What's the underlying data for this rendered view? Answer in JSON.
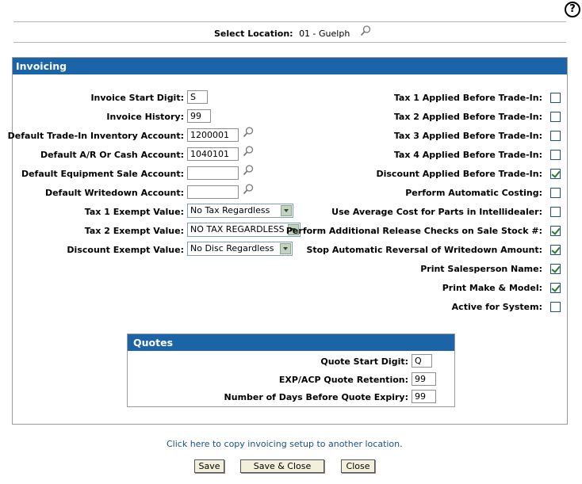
{
  "header": {
    "help_label": "?",
    "location_label": "Select Location:",
    "location_value": "01 - Guelph"
  },
  "invoicing": {
    "title": "Invoicing",
    "fields": {
      "invoice_start_digit": {
        "label": "Invoice Start Digit:",
        "value": "S"
      },
      "invoice_history": {
        "label": "Invoice History:",
        "value": "99"
      },
      "default_tradein_account": {
        "label": "Default Trade-In Inventory Account:",
        "value": "1200001"
      },
      "default_ar_cash_account": {
        "label": "Default A/R Or Cash Account:",
        "value": "1040101"
      },
      "default_equipment_sale_account": {
        "label": "Default Equipment Sale Account:",
        "value": ""
      },
      "default_writedown_account": {
        "label": "Default Writedown Account:",
        "value": ""
      },
      "tax1_exempt": {
        "label": "Tax 1 Exempt Value:",
        "value": "No Tax Regardless"
      },
      "tax2_exempt": {
        "label": "Tax 2 Exempt Value:",
        "value": "NO TAX REGARDLESS"
      },
      "discount_exempt": {
        "label": "Discount Exempt Value:",
        "value": "No Disc Regardless"
      }
    },
    "checks": [
      {
        "label": "Tax 1 Applied Before Trade-In:",
        "checked": false
      },
      {
        "label": "Tax 2 Applied Before Trade-In:",
        "checked": false
      },
      {
        "label": "Tax 3 Applied Before Trade-In:",
        "checked": false
      },
      {
        "label": "Tax 4 Applied Before Trade-In:",
        "checked": false
      },
      {
        "label": "Discount Applied Before Trade-In:",
        "checked": true
      },
      {
        "label": "Perform Automatic Costing:",
        "checked": false
      },
      {
        "label": "Use Average Cost for Parts in Intellidealer:",
        "checked": false
      },
      {
        "label": "Perform Additional Release Checks on Sale Stock #:",
        "checked": true
      },
      {
        "label": "Stop Automatic Reversal of Writedown Amount:",
        "checked": true
      },
      {
        "label": "Print Salesperson Name:",
        "checked": true
      },
      {
        "label": "Print Make & Model:",
        "checked": true
      },
      {
        "label": "Active for System:",
        "checked": false
      }
    ]
  },
  "quotes": {
    "title": "Quotes",
    "start_digit": {
      "label": "Quote Start Digit:",
      "value": "Q"
    },
    "retention": {
      "label": "EXP/ACP Quote Retention:",
      "value": "99"
    },
    "expiry_days": {
      "label": "Number of Days Before Quote Expiry:",
      "value": "99"
    }
  },
  "footer": {
    "copy_link": "Click here to copy invoicing setup to another location.",
    "save_label": "Save",
    "save_close_label": "Save & Close",
    "close_label": "Close"
  }
}
